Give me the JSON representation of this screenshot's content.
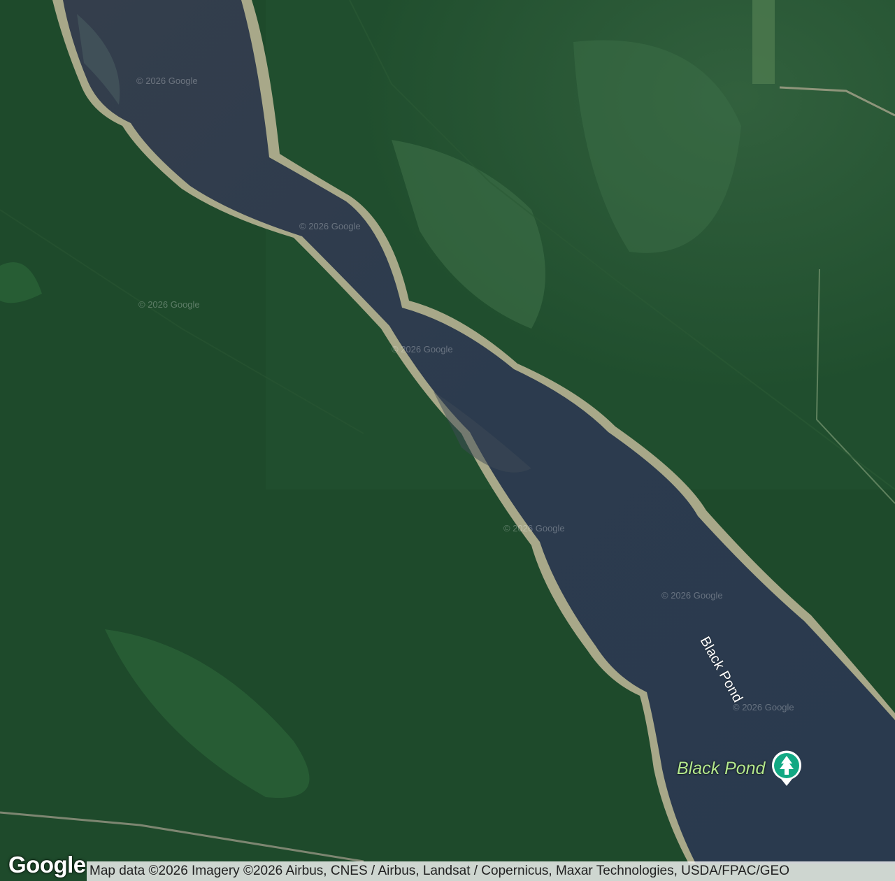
{
  "map": {
    "type": "satellite",
    "water_label": "Black Pond",
    "poi": {
      "label": "Black Pond",
      "icon": "tree-icon",
      "pin_color": "#12a883"
    },
    "watermarks": [
      "© 2026 Google",
      "© 2026 Google",
      "© 2026 Google",
      "© 2026 Google",
      "© 2026 Google",
      "© 2026 Google",
      "© 2026 Google"
    ],
    "logo": "Google",
    "attribution": "Map data ©2026 Imagery ©2026 Airbus, CNES / Airbus, Landsat / Copernicus, Maxar Technologies, USDA/FPAC/GEO",
    "colors": {
      "forest": "#1f4a2c",
      "water": "#2b3a4a",
      "shore": "#b9b59a",
      "poi_label": "#b4e88e"
    }
  }
}
